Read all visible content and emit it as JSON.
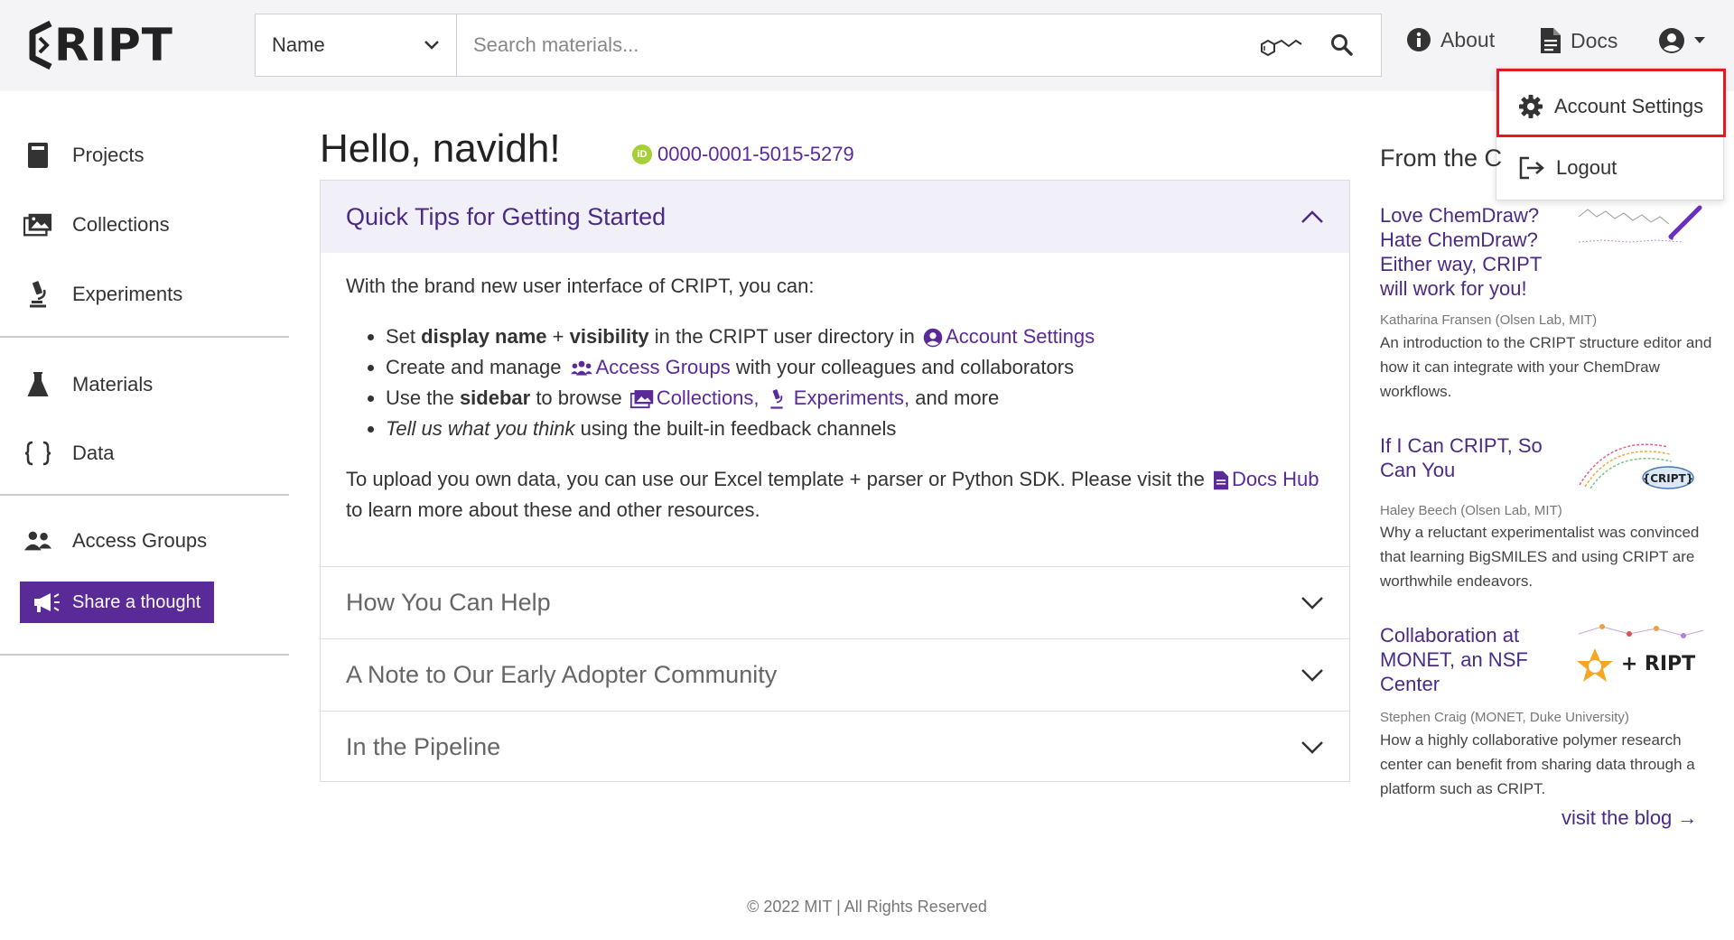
{
  "header": {
    "logo_text": "RIPT",
    "search_type": "Name",
    "search_placeholder": "Search materials...",
    "nav_about": "About",
    "nav_docs": "Docs"
  },
  "account_menu": {
    "settings": "Account Settings",
    "logout": "Logout"
  },
  "sidebar": {
    "projects": "Projects",
    "collections": "Collections",
    "experiments": "Experiments",
    "materials": "Materials",
    "data": "Data",
    "access_groups": "Access Groups",
    "share": "Share a thought"
  },
  "main": {
    "greeting": "Hello, navidh!",
    "orcid_badge": "iD",
    "orcid": "0000-0001-5015-5279",
    "tips": {
      "title": "Quick Tips for Getting Started",
      "intro": "With the brand new user interface of CRIPT, you can:",
      "b1_set": "Set ",
      "b1_display": "display name",
      "b1_plus": " + ",
      "b1_visibility": "visibility",
      "b1_rest": " in the CRIPT user directory in ",
      "b1_link": "Account Settings",
      "b2_pre": "Create and manage ",
      "b2_link": "Access Groups",
      "b2_rest": " with your colleagues and collaborators",
      "b3_pre": "Use the ",
      "b3_bold": "sidebar",
      "b3_mid": " to browse ",
      "b3_link1": "Collections,",
      "b3_link2": "Experiments,",
      "b3_rest": " and more",
      "b4_italic": "Tell us what you think",
      "b4_rest": " using the built-in feedback channels",
      "p2_pre": "To upload you own data, you can use our Excel template + parser or Python SDK. Please visit the ",
      "p2_link": "Docs Hub",
      "p2_rest": " to learn more about these and other resources."
    },
    "sections": [
      "How You Can Help",
      "A Note to Our Early Adopter Community",
      "In the Pipeline"
    ]
  },
  "blog": {
    "heading": "From the C",
    "posts": [
      {
        "title": "Love ChemDraw? Hate ChemDraw? Either way, CRIPT will work for you!",
        "author": "Katharina Fransen (Olsen Lab, MIT)",
        "desc": "An introduction to the CRIPT structure editor and how it can integrate with your ChemDraw workflows."
      },
      {
        "title": "If I Can CRIPT, So Can You",
        "author": "Haley Beech (Olsen Lab, MIT)",
        "desc": "Why a reluctant experimentalist was convinced that learning BigSMILES and using CRIPT are worthwhile endeavors.",
        "thumb_label": "{CRIPT}"
      },
      {
        "title": "Collaboration at MONET, an NSF Center",
        "author": "Stephen Craig (MONET, Duke University)",
        "desc": "How a highly collaborative polymer research center can benefit from sharing data through a platform such as CRIPT.",
        "thumb_label": "+ RIPT"
      }
    ],
    "visit": "visit the blog →"
  },
  "footer": "© 2022 MIT | All Rights Reserved",
  "colors": {
    "accent": "#5b2a99",
    "highlight": "#e01b24"
  }
}
